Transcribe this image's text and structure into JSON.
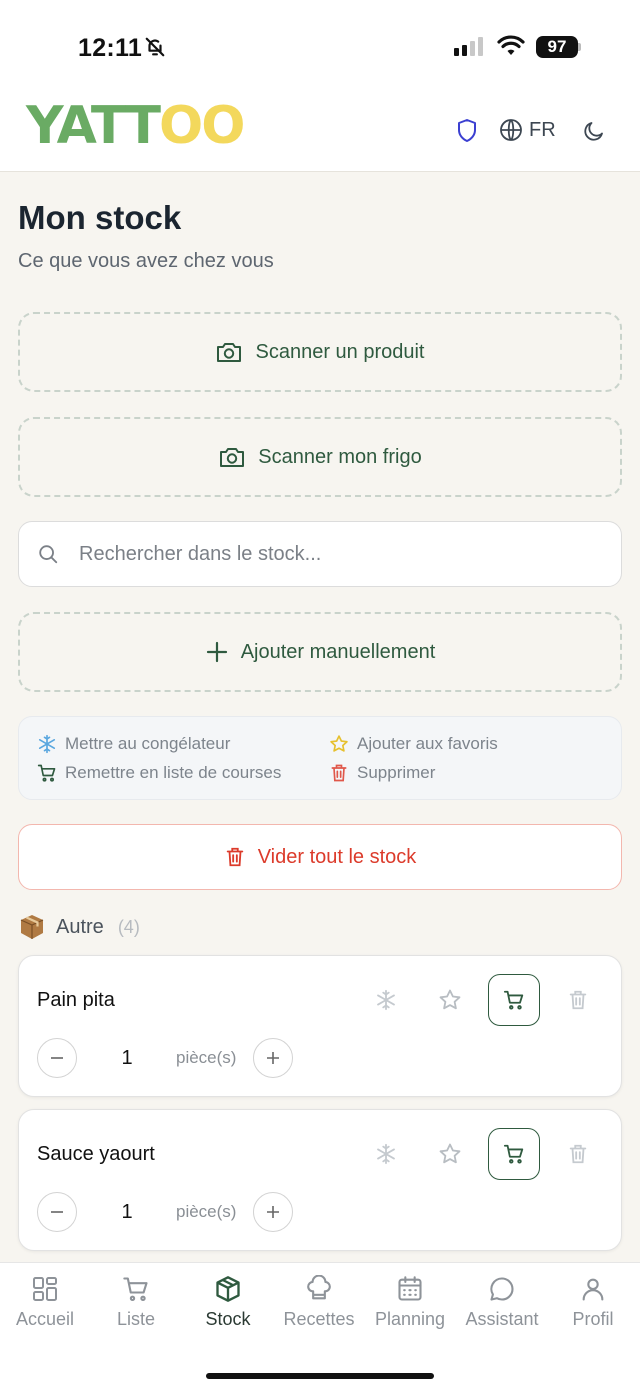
{
  "status_bar": {
    "time": "12:11",
    "battery": "97"
  },
  "header": {
    "logo_green": "YATT",
    "logo_yellow": "OO",
    "language": "FR"
  },
  "page": {
    "title": "Mon stock",
    "subtitle": "Ce que vous avez chez vous"
  },
  "actions": {
    "scan_product": "Scanner un produit",
    "scan_fridge": "Scanner mon frigo",
    "search_placeholder": "Rechercher dans le stock...",
    "add_manual": "Ajouter manuellement",
    "clear_stock": "Vider tout le stock"
  },
  "legend": {
    "freeze": "Mettre au congélateur",
    "favorite": "Ajouter aux favoris",
    "to_list": "Remettre en liste de courses",
    "delete": "Supprimer"
  },
  "category": {
    "icon": "package-icon",
    "name": "Autre",
    "count": "(4)"
  },
  "items": [
    {
      "name": "Pain pita",
      "quantity": "1",
      "unit": "pièce(s)"
    },
    {
      "name": "Sauce yaourt",
      "quantity": "1",
      "unit": "pièce(s)"
    }
  ],
  "nav": [
    {
      "label": "Accueil",
      "icon": "grid-icon",
      "active": false
    },
    {
      "label": "Liste",
      "icon": "cart-icon",
      "active": false
    },
    {
      "label": "Stock",
      "icon": "box-icon",
      "active": true
    },
    {
      "label": "Recettes",
      "icon": "chef-hat-icon",
      "active": false
    },
    {
      "label": "Planning",
      "icon": "calendar-icon",
      "active": false
    },
    {
      "label": "Assistant",
      "icon": "chat-icon",
      "active": false
    },
    {
      "label": "Profil",
      "icon": "user-icon",
      "active": false
    }
  ],
  "colors": {
    "brand_green": "#6aab64",
    "brand_yellow": "#f3d85c",
    "accent_dark_green": "#2f5a3f",
    "danger_red": "#dc3b2b",
    "background": "#f7f5f0"
  }
}
